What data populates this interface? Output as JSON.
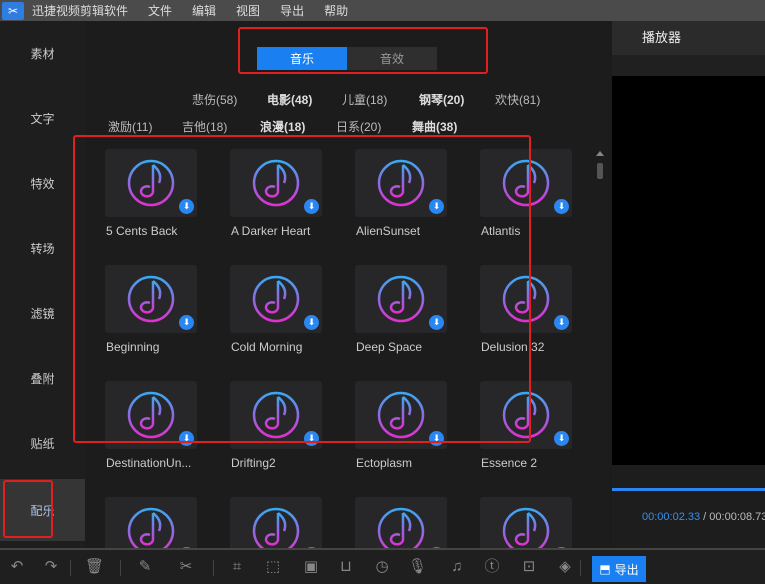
{
  "app": {
    "title": "迅捷视频剪辑软件",
    "menus": [
      "文件",
      "编辑",
      "视图",
      "导出",
      "帮助"
    ]
  },
  "sidebar": {
    "items": [
      {
        "label": "素材"
      },
      {
        "label": "文字"
      },
      {
        "label": "特效"
      },
      {
        "label": "转场"
      },
      {
        "label": "滤镜"
      },
      {
        "label": "叠附"
      },
      {
        "label": "贴纸"
      },
      {
        "label": "配乐",
        "active": true
      }
    ]
  },
  "tabs": [
    {
      "label": "音乐",
      "active": true
    },
    {
      "label": "音效"
    }
  ],
  "categories_row1": [
    "悲伤(58)",
    "电影(48)",
    "儿童(18)",
    "钢琴(20)",
    "欢快(81)"
  ],
  "categories_row2": [
    "激励(11)",
    "吉他(18)",
    "浪漫(18)",
    "日系(20)",
    "舞曲(38)"
  ],
  "tracks": [
    "5 Cents Back",
    "A Darker Heart",
    "AlienSunset",
    "Atlantis",
    "Beginning",
    "Cold Morning",
    "Deep Space",
    "Delusion 32",
    "DestinationUn...",
    "Drifting2",
    "Ectoplasm",
    "Essence 2",
    "",
    "",
    "",
    ""
  ],
  "player": {
    "title": "播放器",
    "current_time": "00:00:02.33",
    "total_time": "00:00:08.73",
    "separator": " / "
  },
  "toolbar": {
    "export_label": "导出"
  },
  "colors": {
    "accent": "#1a7ff0",
    "highlight": "#e02020"
  }
}
